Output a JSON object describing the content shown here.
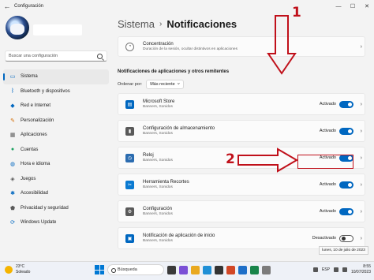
{
  "window": {
    "title": "Configuración",
    "back_glyph": "←",
    "controls": {
      "minimize": "—",
      "maximize": "☐",
      "close": "✕"
    }
  },
  "sidebar": {
    "search_placeholder": "Buscar una configuración",
    "items": [
      {
        "label": "Sistema",
        "icon": "monitor-icon",
        "color": "#0067c0",
        "active": true
      },
      {
        "label": "Bluetooth y dispositivos",
        "icon": "bluetooth-icon",
        "color": "#0067c0"
      },
      {
        "label": "Red e Internet",
        "icon": "wifi-icon",
        "color": "#0067c0"
      },
      {
        "label": "Personalización",
        "icon": "brush-icon",
        "color": "#d36b00"
      },
      {
        "label": "Aplicaciones",
        "icon": "apps-icon",
        "color": "#5a5a5a"
      },
      {
        "label": "Cuentas",
        "icon": "person-icon",
        "color": "#1aa15f"
      },
      {
        "label": "Hora e idioma",
        "icon": "globe-clock-icon",
        "color": "#0067c0"
      },
      {
        "label": "Juegos",
        "icon": "gamepad-icon",
        "color": "#5a5a5a"
      },
      {
        "label": "Accesibilidad",
        "icon": "accessibility-icon",
        "color": "#0067c0"
      },
      {
        "label": "Privacidad y seguridad",
        "icon": "shield-icon",
        "color": "#5a5a5a"
      },
      {
        "label": "Windows Update",
        "icon": "update-icon",
        "color": "#0067c0"
      }
    ]
  },
  "main": {
    "breadcrumb": {
      "parent": "Sistema",
      "separator": "›",
      "current": "Notificaciones"
    },
    "focus_card": {
      "title": "Concentración",
      "subtitle": "Duración de la sesión, ocultar distintivos en aplicaciones",
      "icon": "focus-clock-icon"
    },
    "section_title": "Notificaciones de aplicaciones y otros remitentes",
    "sort": {
      "label": "Ordenar por:",
      "value": "Más reciente"
    },
    "apps": [
      {
        "name": "Microsoft Store",
        "subtitle": "Banners, Sonidos",
        "status": "Activado",
        "on": true,
        "icon": "store-icon",
        "color": "#0067c0"
      },
      {
        "name": "Configuración de almacenamiento",
        "subtitle": "Banners, Sonidos",
        "status": "Activado",
        "on": true,
        "icon": "storage-icon",
        "color": "#5a5a5a"
      },
      {
        "name": "Reloj",
        "subtitle": "Banners, Sonidos",
        "status": "Activado",
        "on": true,
        "icon": "clock-icon",
        "color": "#2b6cb0"
      },
      {
        "name": "Herramienta Recortes",
        "subtitle": "Banners, Sonidos",
        "status": "Activado",
        "on": true,
        "icon": "snipping-icon",
        "color": "#0a7ad1"
      },
      {
        "name": "Configuración",
        "subtitle": "Banners, Sonidos",
        "status": "Activado",
        "on": true,
        "icon": "gear-icon",
        "color": "#5a5a5a"
      },
      {
        "name": "Notificación de aplicación de inicio",
        "subtitle": "Banners, Sonidos",
        "status": "Desactivado",
        "on": false,
        "icon": "startup-icon",
        "color": "#0067c0"
      }
    ],
    "date_tooltip": "lunes, 10 de julio de 2023"
  },
  "annotations": {
    "one": "1",
    "two": "2",
    "color": "#c0101a"
  },
  "taskbar": {
    "weather_temp": "23°C",
    "weather_desc": "Soleado",
    "search_label": "Búsqueda",
    "time": "8:55",
    "date": "10/07/2023",
    "lang": "ESP"
  }
}
